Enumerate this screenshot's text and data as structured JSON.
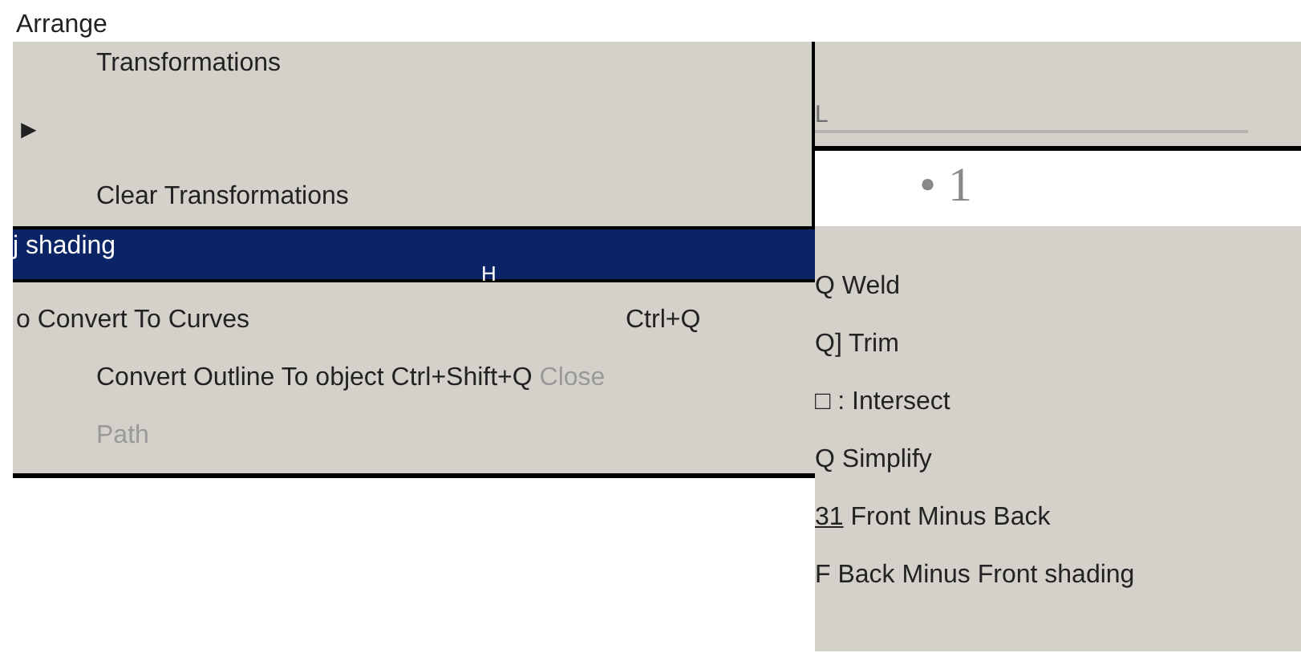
{
  "title": "Arrange",
  "menu_items": [
    {
      "parts": [
        {
          "text": "Transformations",
          "disabled": false
        }
      ],
      "indent": true,
      "selected": false
    },
    {
      "parts": [
        {
          "text": "►",
          "disabled": false
        }
      ],
      "indent": false,
      "selected": false
    },
    {
      "parts": [
        {
          "text": "Clear Transformations",
          "disabled": false
        }
      ],
      "indent": true,
      "selected": false
    },
    {
      "parts": [
        {
          "text": "j shading",
          "disabled": false
        }
      ],
      "indent": false,
      "selected": true,
      "mark": "H"
    },
    {
      "parts": [
        {
          "text": "o Convert To Curves",
          "disabled": false
        }
      ],
      "shortcut": "Ctrl+Q",
      "indent": false,
      "selected": false
    },
    {
      "parts": [
        {
          "text": "Convert Outline To object Ctrl+Shift+Q",
          "disabled": false
        },
        {
          "text": "Close",
          "disabled": true
        }
      ],
      "indent": true,
      "selected": false
    },
    {
      "parts": [
        {
          "text": "Path",
          "disabled": true
        }
      ],
      "indent": true,
      "selected": false
    }
  ],
  "field": {
    "value": "L"
  },
  "bullet": {
    "text": "• 1"
  },
  "shaping_items": [
    {
      "prefix": "Q",
      "underlined": false,
      "label": "Weld"
    },
    {
      "prefix": "Q]",
      "underlined": false,
      "label": "Trim"
    },
    {
      "prefix": "□ :",
      "underlined": false,
      "label": "Intersect"
    },
    {
      "prefix": "Q",
      "underlined": false,
      "label": "Simplify"
    },
    {
      "prefix": "31",
      "underlined": true,
      "label": "Front Minus Back"
    },
    {
      "prefix": "F",
      "underlined": false,
      "label": "Back Minus Front shading"
    }
  ]
}
